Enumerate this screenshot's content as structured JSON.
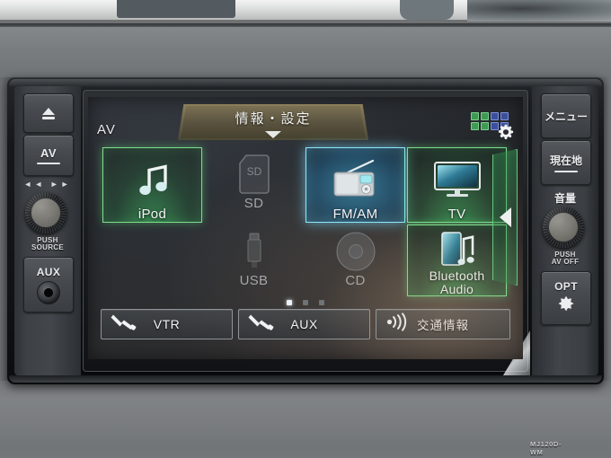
{
  "device": {
    "model_label": "MJ120D-WM"
  },
  "screen": {
    "av_tag": "AV",
    "pulldown_tab": {
      "label": "情報・設定",
      "arrow_icon": "chevron-down-icon"
    },
    "app_grid_icon": "app-grid-icon",
    "settings_gear_icon": "gear-icon",
    "page_arrow_icon": "chevron-left-icon",
    "page_dots": {
      "count": 3,
      "active_index": 0
    },
    "tiles": [
      {
        "id": "ipod",
        "label": "iPod",
        "icon": "music-note-icon",
        "state": "enabled",
        "highlight": "green"
      },
      {
        "id": "sd",
        "label": "SD",
        "icon": "sd-card-icon",
        "state": "disabled",
        "highlight": "none"
      },
      {
        "id": "fm-am",
        "label": "FM/AM",
        "icon": "radio-icon",
        "state": "selected",
        "highlight": "cyan"
      },
      {
        "id": "tv",
        "label": "TV",
        "icon": "television-icon",
        "state": "enabled",
        "highlight": "green"
      },
      {
        "id": "usb",
        "label": "USB",
        "icon": "usb-connector-icon",
        "state": "disabled",
        "highlight": "none"
      },
      {
        "id": "cd",
        "label": "CD",
        "icon": "compact-disc-icon",
        "state": "disabled",
        "highlight": "none"
      },
      {
        "id": "bluetooth",
        "label": "Bluetooth\nAudio",
        "icon": "bluetooth-audio-icon",
        "state": "enabled",
        "highlight": "green"
      }
    ],
    "bottom_buttons": [
      {
        "id": "vtr",
        "label": "VTR",
        "icon": "plug-connector-icon"
      },
      {
        "id": "aux",
        "label": "AUX",
        "icon": "plug-connector-icon"
      },
      {
        "id": "traffic",
        "label": "交通情報",
        "icon": "broadcast-signal-icon"
      }
    ]
  },
  "hardware": {
    "left": {
      "eject_button": {
        "label": "",
        "icon": "eject-icon"
      },
      "av_button": {
        "label": "AV",
        "icon": "av-icon"
      },
      "skip_icons": "◄◄  ►►",
      "source_knob": {
        "icon": "rotary-knob-icon",
        "caption_line1": "PUSH",
        "caption_line2": "SOURCE"
      },
      "aux_jack": {
        "label": "AUX",
        "icon": "audio-jack-icon"
      }
    },
    "right": {
      "menu_button": {
        "label": "メニュー"
      },
      "location_button": {
        "label": "現在地"
      },
      "volume_label": "音量",
      "volume_knob": {
        "icon": "rotary-knob-icon",
        "caption_line1": "PUSH",
        "caption_line2": "AV OFF"
      },
      "opt_button": {
        "label": "OPT",
        "icon": "flower-asterisk-icon"
      }
    }
  },
  "colors": {
    "green_accent": "#7ede8c",
    "cyan_accent": "#8fe6ff",
    "tab_gold": "#7b7053",
    "disabled_text": "#a3a5a7"
  }
}
